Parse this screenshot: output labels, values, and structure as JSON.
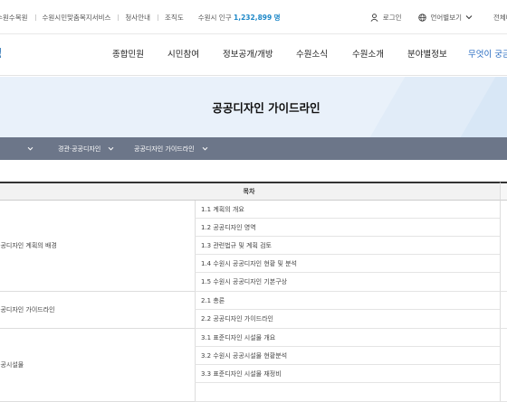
{
  "utility": {
    "links": [
      "수원수목원",
      "수원시민맞춤복지서비스",
      "청사안내",
      "조직도"
    ],
    "population_label": "수원시 인구",
    "population_value": "1,232,899",
    "population_unit": "명",
    "login": "로그인",
    "language": "언어별보기",
    "sitemap": "전체메뉴"
  },
  "logo_fragment": "!",
  "nav": {
    "items": [
      "종합민원",
      "시민참여",
      "정보공개/개방",
      "수원소식",
      "수원소개",
      "분야별정보",
      "무엇이 궁금해"
    ]
  },
  "hero": {
    "title": "공공디자인 가이드라인"
  },
  "breadcrumb": {
    "items": [
      "",
      "경관·공공디자인",
      "공공디자인 가이드라인"
    ]
  },
  "table": {
    "header": "목차",
    "categories": [
      "공공디자인 계획의 배경",
      "공공디자인 가이드라인",
      "공공시설물"
    ],
    "rows": [
      "1.1 계획의 개요",
      "1.2 공공디자인 영역",
      "1.3 관련법규 및 계획 검토",
      "1.4 수원시 공공디자인 현황 및 분석",
      "1.5 수원시 공공디자인 기본구상",
      "2.1 총론",
      "2.2 공공디자인 가이드라인",
      "3.1 표준디자인 시설물 개요",
      "3.2 수원시 공공시설물 현황분석",
      "3.3 표준디자인 시설물 재정비",
      ""
    ]
  },
  "colors": {
    "accent": "#1e88c8",
    "nav_active": "#2a6dc2",
    "breadcrumb_bg": "#6c7689",
    "hero_bg": "#e9f1fa"
  }
}
